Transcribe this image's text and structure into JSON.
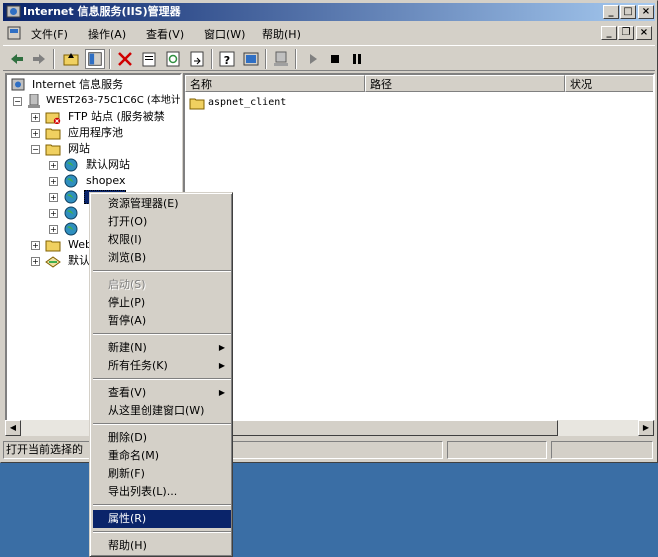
{
  "window": {
    "title": "Internet 信息服务(IIS)管理器"
  },
  "menubar": [
    "文件(F)",
    "操作(A)",
    "查看(V)",
    "窗口(W)",
    "帮助(H)"
  ],
  "tree": {
    "root": "Internet 信息服务",
    "server": "WEST263-75C1C6C (本地计",
    "ftp": "FTP 站点 (服务被禁",
    "apppools": "应用程序池",
    "websites": "网站",
    "default_site": "默认网站",
    "shopex": "shopex",
    "web_ext": "Web",
    "default_smtp": "默认"
  },
  "list": {
    "columns": [
      "名称",
      "路径",
      "状况"
    ],
    "rows": [
      {
        "name": "aspnet_client"
      }
    ]
  },
  "statusbar": {
    "text": "打开当前选择的"
  },
  "context_menu": {
    "explorer": "资源管理器(E)",
    "open": "打开(O)",
    "permissions": "权限(I)",
    "browse": "浏览(B)",
    "start": "启动(S)",
    "stop": "停止(P)",
    "pause": "暂停(A)",
    "new": "新建(N)",
    "all_tasks": "所有任务(K)",
    "view": "查看(V)",
    "new_window": "从这里创建窗口(W)",
    "delete": "删除(D)",
    "rename": "重命名(M)",
    "refresh": "刷新(F)",
    "export": "导出列表(L)...",
    "properties": "属性(R)",
    "help": "帮助(H)"
  },
  "colors": {
    "titlebar": "#0a246a",
    "desktop": "#3a6ea5",
    "selection": "#0a246a"
  },
  "icons": [
    "back-icon",
    "forward-icon",
    "up-folder-icon",
    "show-tree-icon",
    "delete-icon",
    "properties-icon",
    "refresh-icon",
    "export-icon",
    "help-icon",
    "console-icon",
    "server-icon",
    "play-icon",
    "stop-icon",
    "pause-icon"
  ]
}
